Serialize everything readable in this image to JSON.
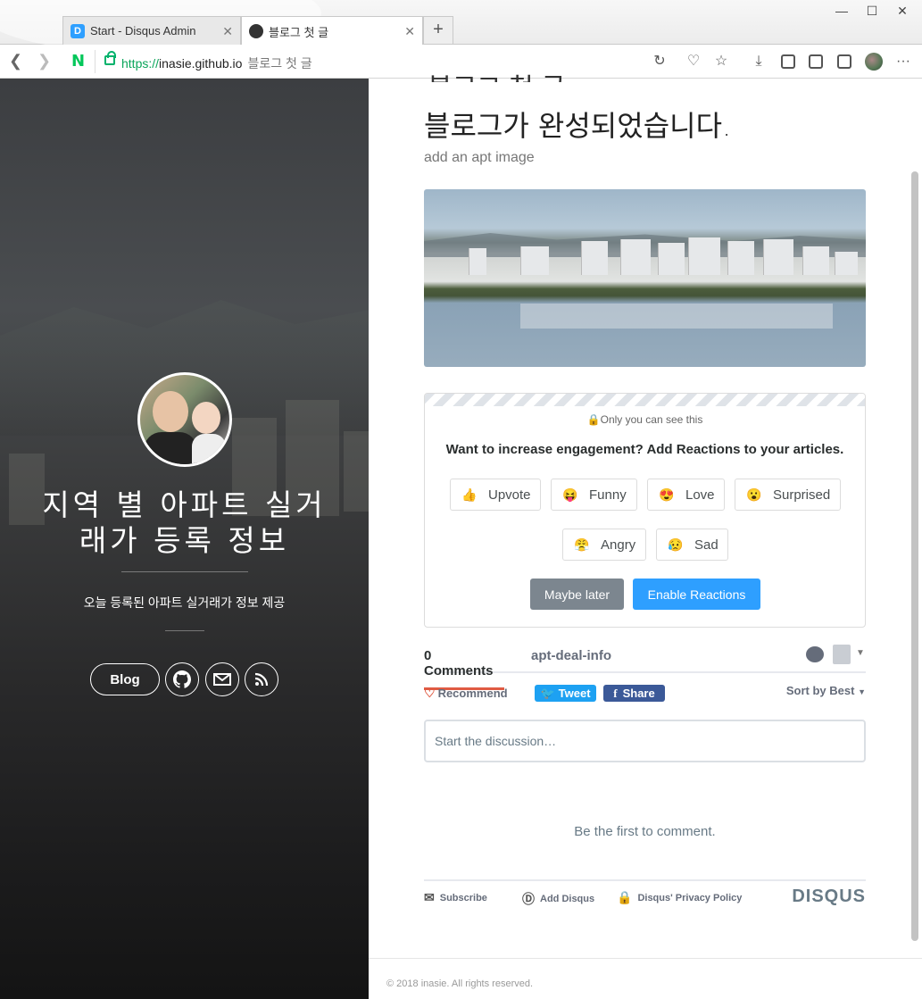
{
  "browser": {
    "tabs": [
      {
        "label": "Start - Disqus Admin",
        "favicon": "D"
      },
      {
        "label": "블로그 첫 글"
      }
    ],
    "new_tab_label": "+",
    "window_controls": {
      "minimize": "—",
      "maximize": "☐",
      "close": "✕"
    },
    "address": {
      "scheme": "https://",
      "host": "inasie.github.io",
      "page_title": "블로그 첫 글"
    },
    "naver_label": "N",
    "more_label": "···"
  },
  "sidebar": {
    "site_title": "지역 별 아파트 실거래가 등록 정보",
    "description": "오늘 등록된 아파트 실거래가 정보 제공",
    "blog_button": "Blog"
  },
  "post": {
    "cut_title": "블로그 첫 글",
    "heading": "블로그가 완성되었습니다.",
    "subheading": "add an apt image"
  },
  "reactions": {
    "visibility_note": "Only you can see this",
    "question": "Want to increase engagement? Add Reactions to your articles.",
    "items": [
      {
        "label": "Upvote",
        "icon": "thumbs-up-icon",
        "glyph": "👍"
      },
      {
        "label": "Funny",
        "icon": "funny-icon",
        "glyph": "😝"
      },
      {
        "label": "Love",
        "icon": "love-icon",
        "glyph": "😍"
      },
      {
        "label": "Surprised",
        "icon": "surprised-icon",
        "glyph": "😮"
      },
      {
        "label": "Angry",
        "icon": "angry-icon",
        "glyph": "😤"
      },
      {
        "label": "Sad",
        "icon": "sad-icon",
        "glyph": "😥"
      }
    ],
    "maybe_later": "Maybe later",
    "enable": "Enable Reactions"
  },
  "disqus": {
    "comments_tab": "0 Comments",
    "site_tab": "apt-deal-info",
    "recommend": "Recommend",
    "tweet": "Tweet",
    "share": "Share",
    "sort": "Sort by Best",
    "input_placeholder": "Start the discussion…",
    "empty_state": "Be the first to comment.",
    "footer": {
      "subscribe": "Subscribe",
      "add_disqus": "Add Disqus",
      "privacy": "Disqus' Privacy Policy",
      "logo": "DISQUS"
    }
  },
  "footer": {
    "copyright": "© 2018 inasie. All rights reserved."
  },
  "colors": {
    "accent": "#2e9fff",
    "tab_underline": "#e05b43",
    "maybe_later": "#7c868f",
    "twitter": "#1da1f2",
    "facebook": "#3b5998"
  }
}
